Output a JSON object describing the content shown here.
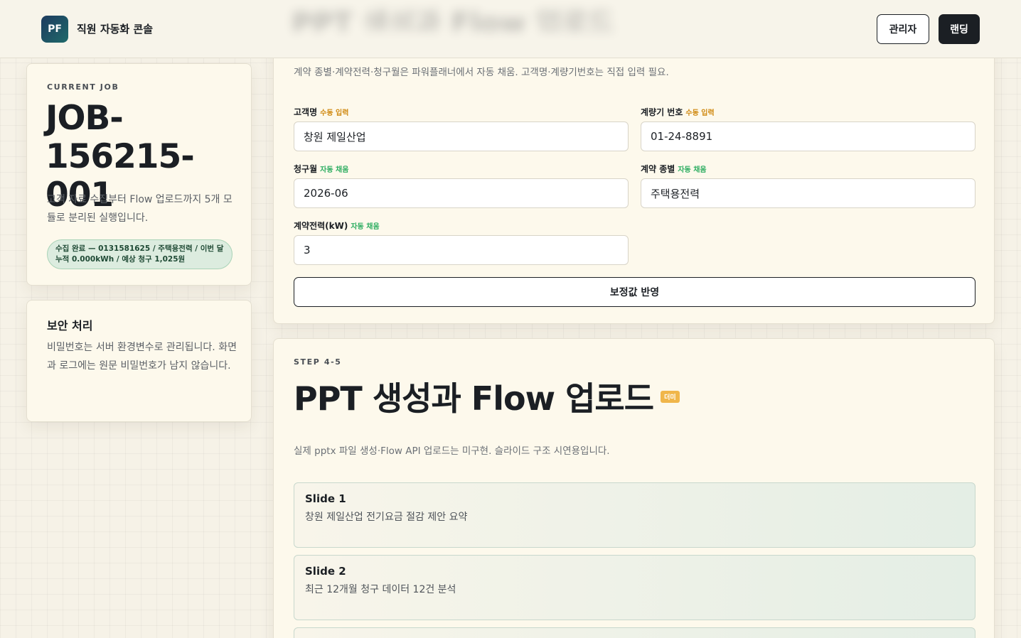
{
  "header": {
    "logo": "PF",
    "brand": "직원 자동화 콘솔",
    "admin_label": "관리자",
    "landing_label": "랜딩"
  },
  "job": {
    "eyebrow": "CURRENT JOB",
    "id": "JOB-156215-001",
    "desc": "고객 자료 수집부터 Flow 업로드까지 5개 모듈로 분리된 실행입니다.",
    "status": "수집 완료 — 0131581625 / 주택용전력 / 이번 달 누적 0.000kWh / 예상 청구 1,025원"
  },
  "security": {
    "title": "보안 처리",
    "body": "비밀번호는 서버 환경변수로 관리됩니다. 화면과 로그에는 원문 비밀번호가 남지 않습니다."
  },
  "form": {
    "note": "계약 종별·계약전력·청구월은 파워플래너에서 자동 채움. 고객명·계량기번호는 직접 입력 필요.",
    "manual_tag": "수동 입력",
    "auto_tag": "자동 채움",
    "customer_label": "고객명",
    "customer_value": "창원 제일산업",
    "meter_label": "계량기 번호",
    "meter_value": "01-24-8891",
    "month_label": "청구월",
    "month_value": "2026-06",
    "contract_type_label": "계약 종별",
    "contract_type_value": "주택용전력",
    "power_label": "계약전력(kW)",
    "power_value": "3",
    "apply_label": "보정값 반영"
  },
  "ppt": {
    "eyebrow": "STEP 4-5",
    "title": "PPT 생성과 Flow 업로드",
    "badge": "더미",
    "note": "실제 pptx 파일 생성·Flow API 업로드는 미구현. 슬라이드 구조 시연용입니다.",
    "slides": [
      {
        "name": "Slide 1",
        "desc": "창원 제일산업 전기요금 절감 제안 요약"
      },
      {
        "name": "Slide 2",
        "desc": "최근 12개월 청구 데이터 12건 분석"
      }
    ]
  },
  "colors": {
    "accent_dark": "#1b1f24",
    "manual_tag": "#d08a12",
    "auto_tag": "#2fae62",
    "status_bg": "#dcecdf"
  }
}
